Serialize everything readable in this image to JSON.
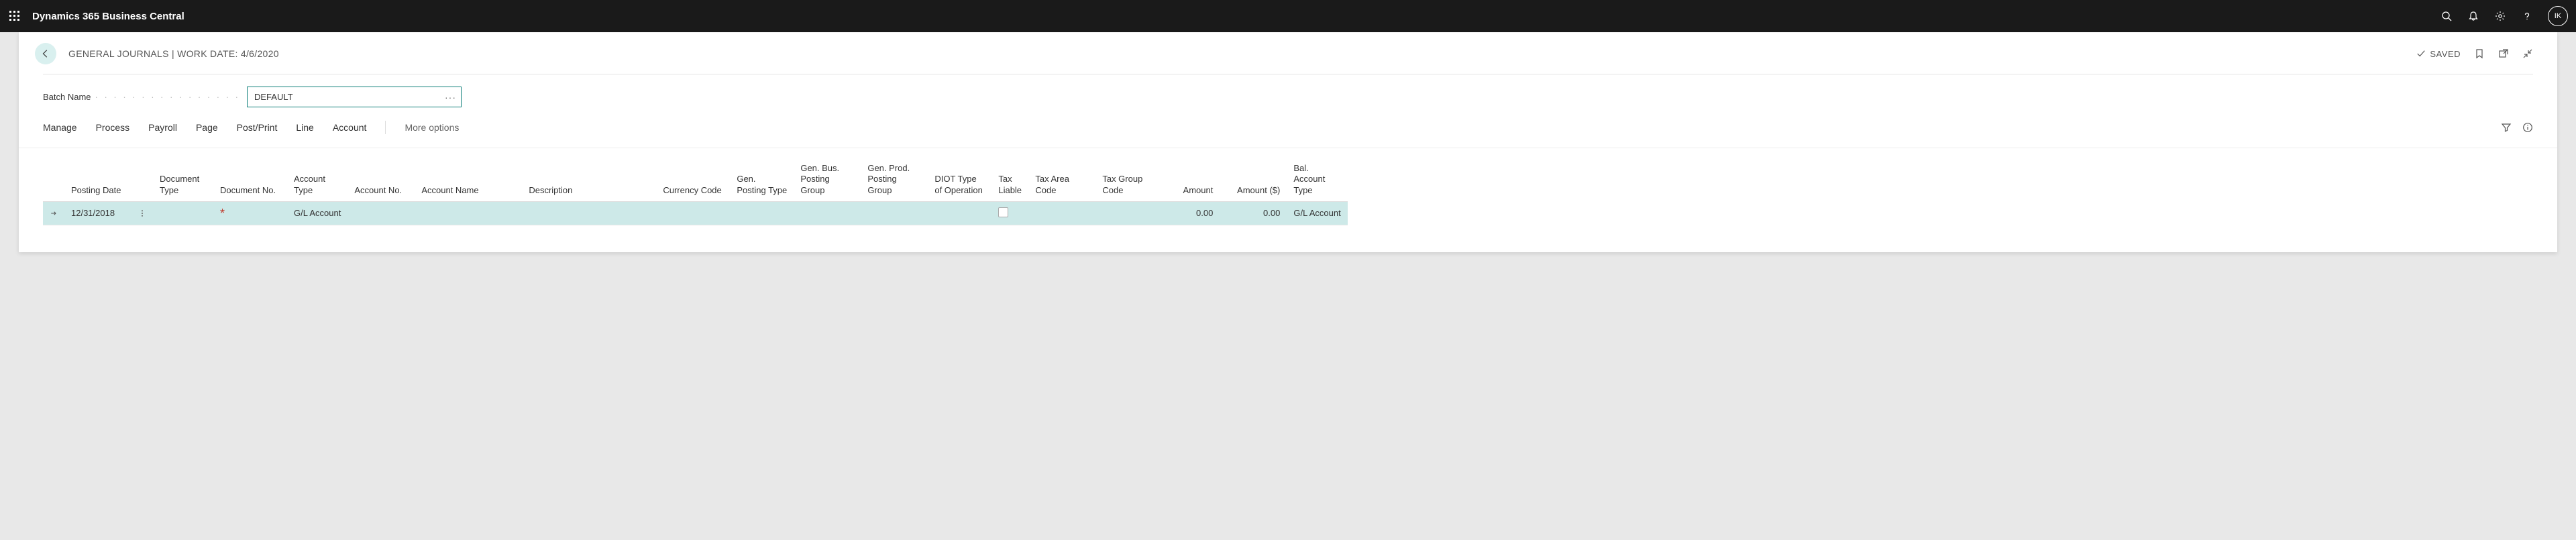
{
  "topbar": {
    "title": "Dynamics 365 Business Central",
    "avatar_initials": "IK"
  },
  "header": {
    "breadcrumb": "GENERAL JOURNALS | WORK DATE: 4/6/2020",
    "saved_label": "SAVED"
  },
  "batch": {
    "label": "Batch Name",
    "value": "DEFAULT"
  },
  "actions": {
    "items": [
      "Manage",
      "Process",
      "Payroll",
      "Page",
      "Post/Print",
      "Line",
      "Account"
    ],
    "more": "More options"
  },
  "table": {
    "columns": [
      "Posting Date",
      "Document Type",
      "Document No.",
      "Account Type",
      "Account No.",
      "Account Name",
      "Description",
      "Currency Code",
      "Gen. Posting Type",
      "Gen. Bus. Posting Group",
      "Gen. Prod. Posting Group",
      "DIOT Type of Operation",
      "Tax Liable",
      "Tax Area Code",
      "Tax Group Code",
      "Amount",
      "Amount ($)",
      "Bal. Account Type"
    ],
    "row": {
      "posting_date": "12/31/2018",
      "document_type": "",
      "document_no": "",
      "account_type": "G/L Account",
      "account_no": "",
      "account_name": "",
      "description": "",
      "currency_code": "",
      "gen_posting_type": "",
      "gen_bus_group": "",
      "gen_prod_group": "",
      "diot_type": "",
      "tax_area_code": "",
      "tax_group_code": "",
      "amount": "0.00",
      "amount_usd": "0.00",
      "bal_account_type": "G/L Account"
    }
  }
}
